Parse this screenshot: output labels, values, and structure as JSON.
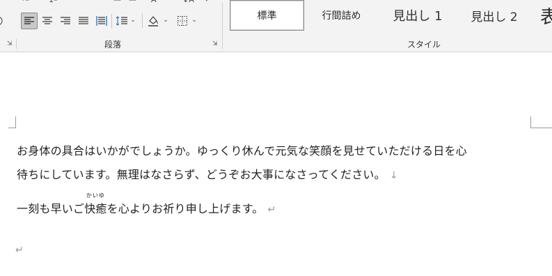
{
  "ribbon": {
    "paragraph_group_label": "段落",
    "styles_group_label": "スタイル",
    "styles": [
      {
        "label": "標準",
        "selected": true
      },
      {
        "label": "行間詰め",
        "selected": false
      },
      {
        "label": "見出し 1",
        "selected": false
      },
      {
        "label": "見出し 2",
        "selected": false
      },
      {
        "label": "表",
        "selected": false
      }
    ],
    "icons": {
      "align_left": "align-left-icon",
      "align_center": "align-center-icon",
      "align_right": "align-right-icon",
      "justify": "justify-icon",
      "distributed": "distributed-icon",
      "line_spacing": "line-spacing-icon",
      "shading": "shading-icon",
      "borders": "borders-icon"
    },
    "colors": {
      "active_tool_bg": "#c9c9c9",
      "ribbon_bg": "#f3f3f3"
    }
  },
  "document": {
    "line1": "お身体の具合はいかがでしょうか。ゆっくり休んで元気な笑顔を見せていただける日を心",
    "line2": "待ちにしています。無理はなさらず、どうぞお大事になさってください。",
    "line2_mark": "↓",
    "para2_before": "一刻も早いご",
    "para2_ruby_base": "快癒",
    "para2_ruby_text": "かいゆ",
    "para2_after": "を心よりお祈り申し上げます。",
    "para_mark": "↵",
    "empty_para_mark": "↵"
  }
}
